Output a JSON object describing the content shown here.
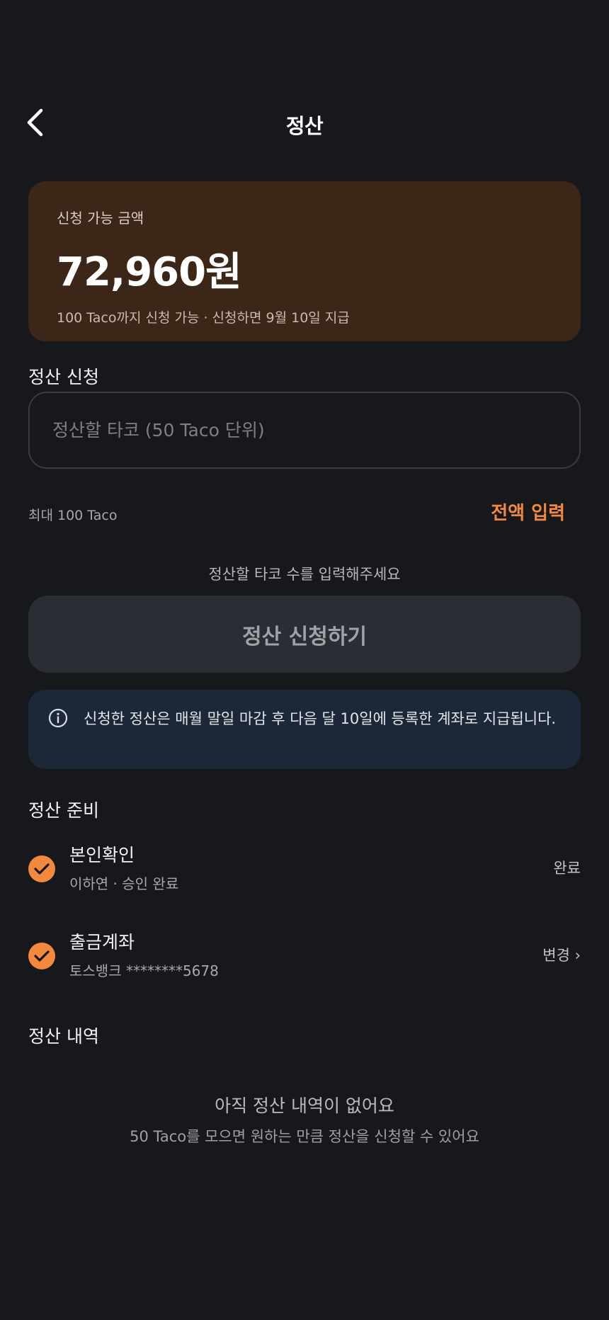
{
  "header": {
    "title": "정산",
    "back_icon": "chevron-left-icon"
  },
  "balance": {
    "label": "신청 가능 금액",
    "amount": "72,960원",
    "note": "100 Taco까지 신청 가능 · 신청하면 9월 10일 지급"
  },
  "request": {
    "section_title": "정산 신청",
    "input_placeholder": "정산할 타코 (50 Taco 단위)",
    "input_value": "",
    "max_note": "최대 100 Taco",
    "full_amount_label": "전액 입력",
    "hint": "정산할 타코 수를 입력해주세요",
    "submit_label": "정산 신청하기"
  },
  "info": {
    "icon": "info-icon",
    "text": "신청한 정산은 매월 말일 마감 후 다음 달 10일에 등록한 계좌로 지급됩니다."
  },
  "prep": {
    "section_title": "정산 준비",
    "items": [
      {
        "title": "본인확인",
        "subtitle": "이하연 · 승인 완료",
        "status": "완료"
      },
      {
        "title": "출금계좌",
        "subtitle": "토스뱅크 ********5678",
        "action": "변경 ›"
      }
    ]
  },
  "history": {
    "section_title": "정산 내역",
    "empty_title": "아직 정산 내역이 없어요",
    "empty_subtitle": "50 Taco를 모으면 원하는 만큼 정산을 신청할 수 있어요"
  },
  "colors": {
    "background": "#17181c",
    "accent": "#f2893d",
    "balance_card": "#3b2617",
    "info_banner": "#1c2838",
    "disabled_button": "#2a2d33"
  }
}
